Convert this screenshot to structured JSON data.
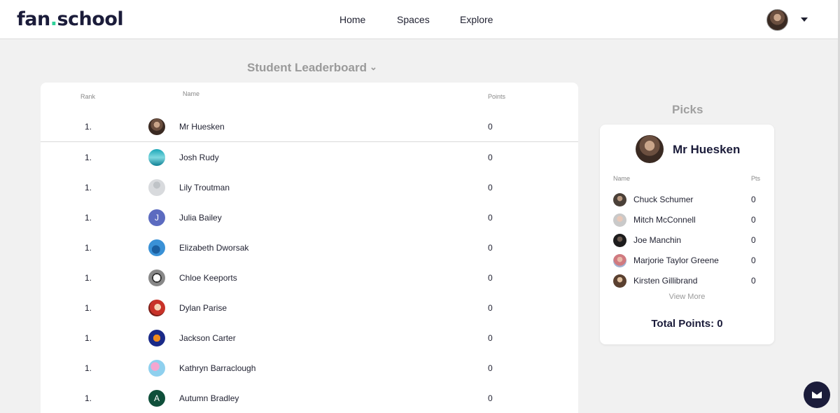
{
  "header": {
    "logo_main": "fan",
    "logo_dot": ".",
    "logo_tail": "school",
    "nav": [
      "Home",
      "Spaces",
      "Explore"
    ]
  },
  "leaderboard": {
    "title": "Student Leaderboard",
    "columns": {
      "rank": "Rank",
      "name": "Name",
      "points": "Points"
    },
    "rows": [
      {
        "rank": "1.",
        "name": "Mr Huesken",
        "points": "0"
      },
      {
        "rank": "1.",
        "name": "Josh Rudy",
        "points": "0"
      },
      {
        "rank": "1.",
        "name": "Lily Troutman",
        "points": "0"
      },
      {
        "rank": "1.",
        "name": "Julia Bailey",
        "points": "0",
        "initial": "J"
      },
      {
        "rank": "1.",
        "name": "Elizabeth Dworsak",
        "points": "0"
      },
      {
        "rank": "1.",
        "name": "Chloe Keeports",
        "points": "0"
      },
      {
        "rank": "1.",
        "name": "Dylan Parise",
        "points": "0"
      },
      {
        "rank": "1.",
        "name": "Jackson Carter",
        "points": "0"
      },
      {
        "rank": "1.",
        "name": "Kathryn Barraclough",
        "points": "0"
      },
      {
        "rank": "1.",
        "name": "Autumn Bradley",
        "points": "0",
        "initial": "A"
      }
    ]
  },
  "picks": {
    "title": "Picks",
    "owner": "Mr Huesken",
    "col_name": "Name",
    "col_pts": "Pts",
    "items": [
      {
        "name": "Chuck Schumer",
        "pts": "0"
      },
      {
        "name": "Mitch McConnell",
        "pts": "0"
      },
      {
        "name": "Joe Manchin",
        "pts": "0"
      },
      {
        "name": "Marjorie Taylor Greene",
        "pts": "0"
      },
      {
        "name": "Kirsten Gillibrand",
        "pts": "0"
      }
    ],
    "view_more": "View More",
    "total": "Total Points: 0"
  },
  "colors": {
    "brand_dark": "#1b1c3a",
    "brand_accent": "#2fd29a"
  }
}
